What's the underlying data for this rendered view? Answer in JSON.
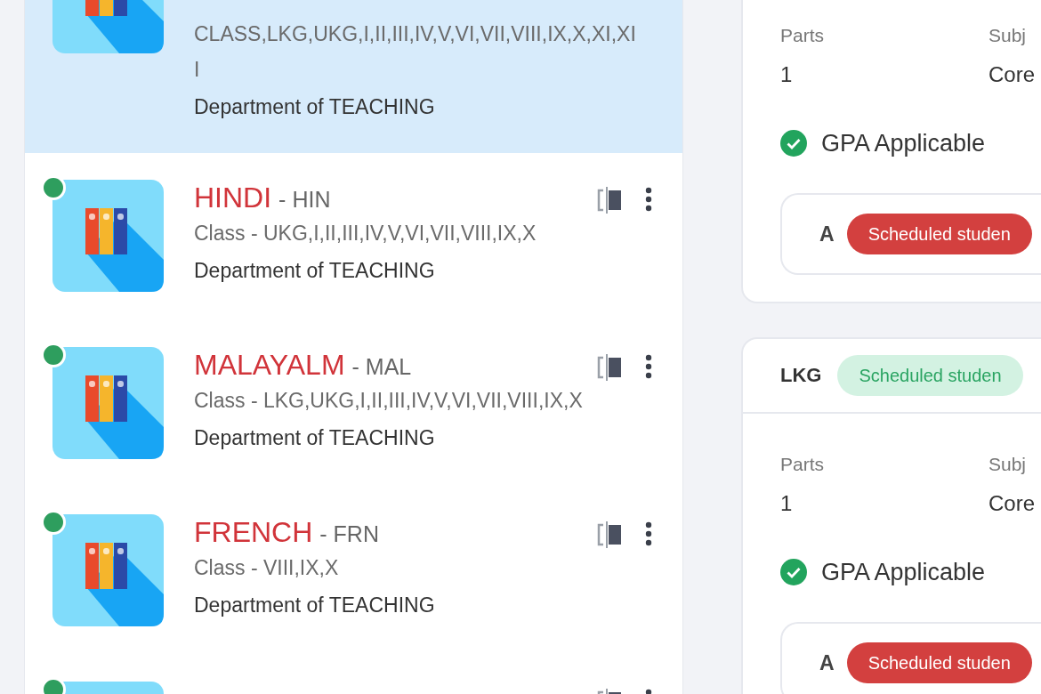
{
  "subjects": [
    {
      "class": "CLASS,LKG,UKG,I,II,III,IV,V,VI,VII,VIII,IX,X,XI,XII",
      "department": "Department of TEACHING",
      "selected": true
    },
    {
      "name": "HINDI",
      "code": "- HIN",
      "class": "Class - UKG,I,II,III,IV,V,VI,VII,VIII,IX,X",
      "department": "Department of TEACHING",
      "selected": false,
      "color": "#2e9e5e"
    },
    {
      "name": "MALAYALM",
      "code": "- MAL",
      "class": "Class - LKG,UKG,I,II,III,IV,V,VI,VII,VIII,IX,X",
      "department": "Department of TEACHING",
      "selected": false,
      "color": "#2e9e5e"
    },
    {
      "name": "FRENCH",
      "code": "- FRN",
      "class": "Class - VIII,IX,X",
      "department": "Department of TEACHING",
      "selected": false,
      "color": "#2e9e5e"
    },
    {
      "selected": false,
      "color": "#2e9e5e"
    }
  ],
  "class_cards": [
    {
      "parts_label": "Parts",
      "parts": "1",
      "subject_label": "Subj",
      "subject": "Core",
      "gpa": "GPA Applicable",
      "sections": [
        {
          "name": "A",
          "status": "Scheduled studen",
          "kind": "alert"
        }
      ]
    },
    {
      "class": "LKG",
      "badge": {
        "text": "Scheduled studen",
        "kind": "success"
      },
      "parts_label": "Parts",
      "parts": "1",
      "subject_label": "Subj",
      "subject": "Core",
      "gpa": "GPA Applicable",
      "sections": [
        {
          "name": "A",
          "status": "Scheduled studen",
          "kind": "alert"
        }
      ]
    }
  ]
}
